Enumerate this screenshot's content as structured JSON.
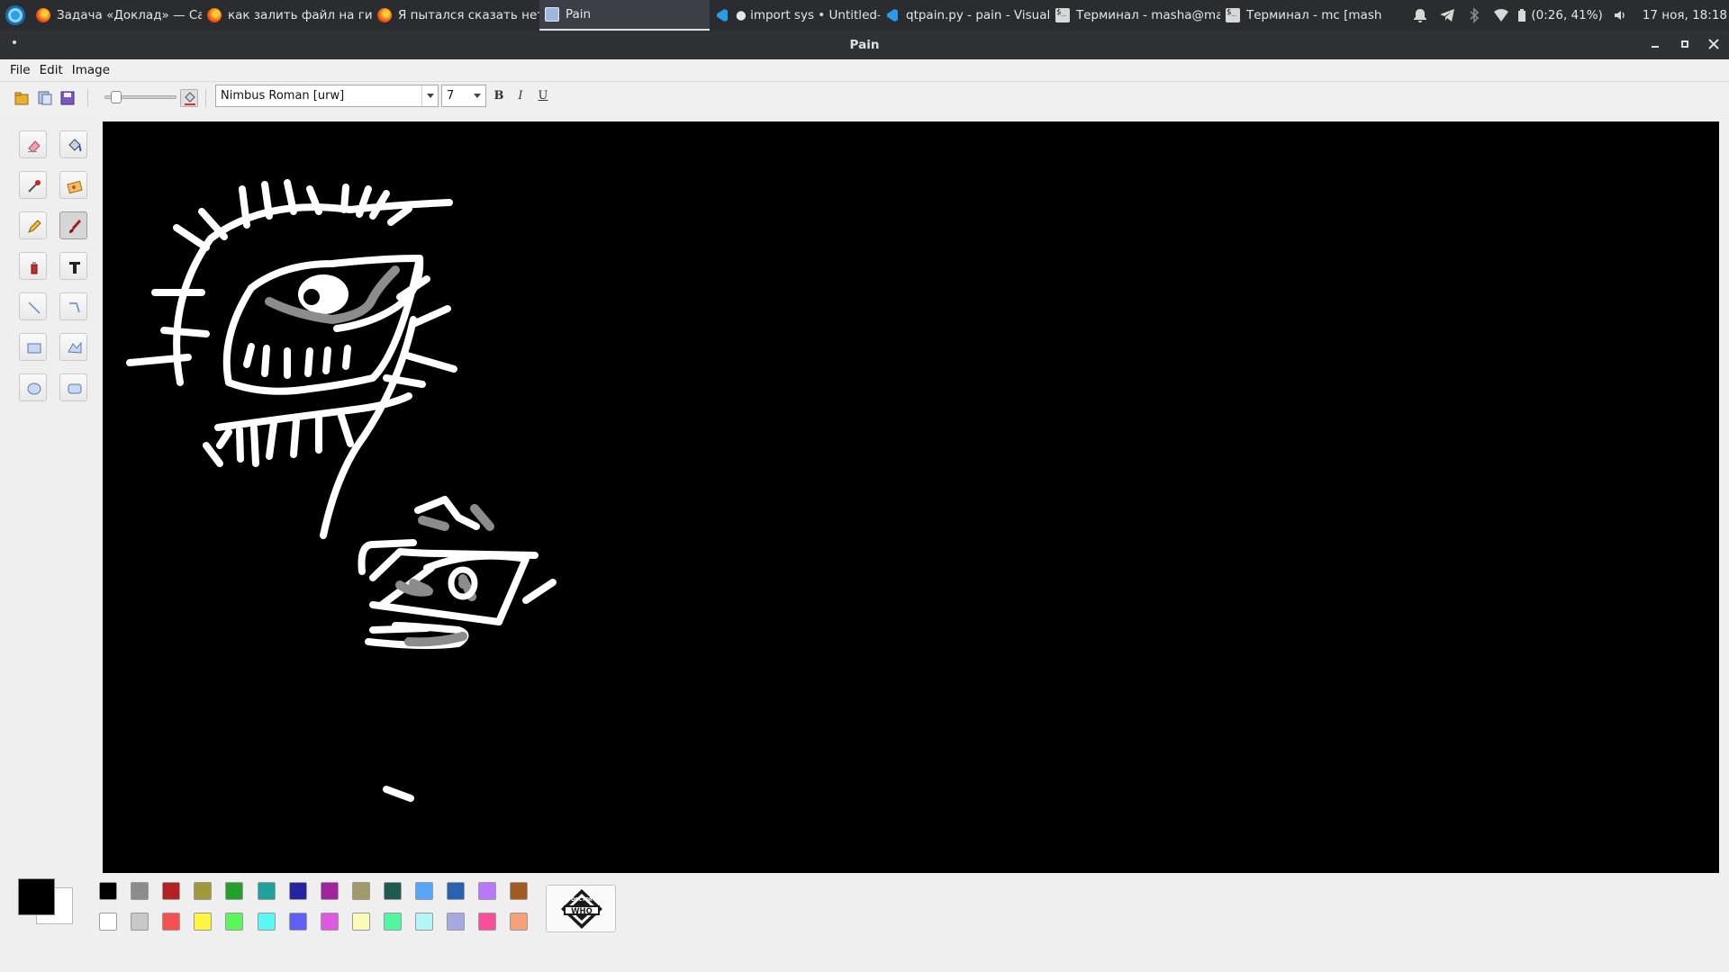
{
  "taskbar": {
    "tasks": [
      {
        "label": "Задача «Доклад» — Са...",
        "icon": "firefox-icon"
      },
      {
        "label": "как залить файл на гит...",
        "icon": "firefox-icon"
      },
      {
        "label": "Я пытался сказать нет ...",
        "icon": "firefox-icon"
      },
      {
        "label": "Pain",
        "icon": "pain-app-icon",
        "active": true
      },
      {
        "label": "● import sys • Untitled-...",
        "icon": "vscode-icon"
      },
      {
        "label": "qtpain.py - pain - Visual S...",
        "icon": "vscode-icon"
      },
      {
        "label": "Терминал - masha@ma...",
        "icon": "terminal-icon"
      },
      {
        "label": "Терминал - mc [masha...",
        "icon": "terminal-icon"
      }
    ],
    "battery": "(0:26, 41%)",
    "clock": "17 ноя, 18:18"
  },
  "window": {
    "title": "Pain"
  },
  "menubar": {
    "file": "File",
    "edit": "Edit",
    "image": "Image"
  },
  "toolbar": {
    "font_family": "Nimbus Roman [urw]",
    "font_size": "7",
    "bold": "B",
    "italic": "I",
    "underline": "U",
    "brush_size_fraction": 0.1
  },
  "tools": {
    "selected": "brush"
  },
  "colors": {
    "foreground": "#000000",
    "background": "#ffffff",
    "palette_top": [
      "#000000",
      "#8c8c8c",
      "#b22222",
      "#a09a38",
      "#22a02a",
      "#21a0a0",
      "#2424a0",
      "#a024a0",
      "#a09a6a",
      "#1e5a4e",
      "#5aa6f6",
      "#2a62b2",
      "#b67af6",
      "#a05a22"
    ],
    "palette_bottom": [
      "#ffffff",
      "#c8c8c8",
      "#f65050",
      "#fcf640",
      "#5af65a",
      "#5af6f6",
      "#6060f6",
      "#e05ae0",
      "#fcfab8",
      "#50f6a0",
      "#b2f6f6",
      "#a8a8e0",
      "#f6509a",
      "#f6a07a"
    ]
  },
  "logo_button": {
    "text_top": "DOCTOR",
    "text_main": "WHO"
  }
}
